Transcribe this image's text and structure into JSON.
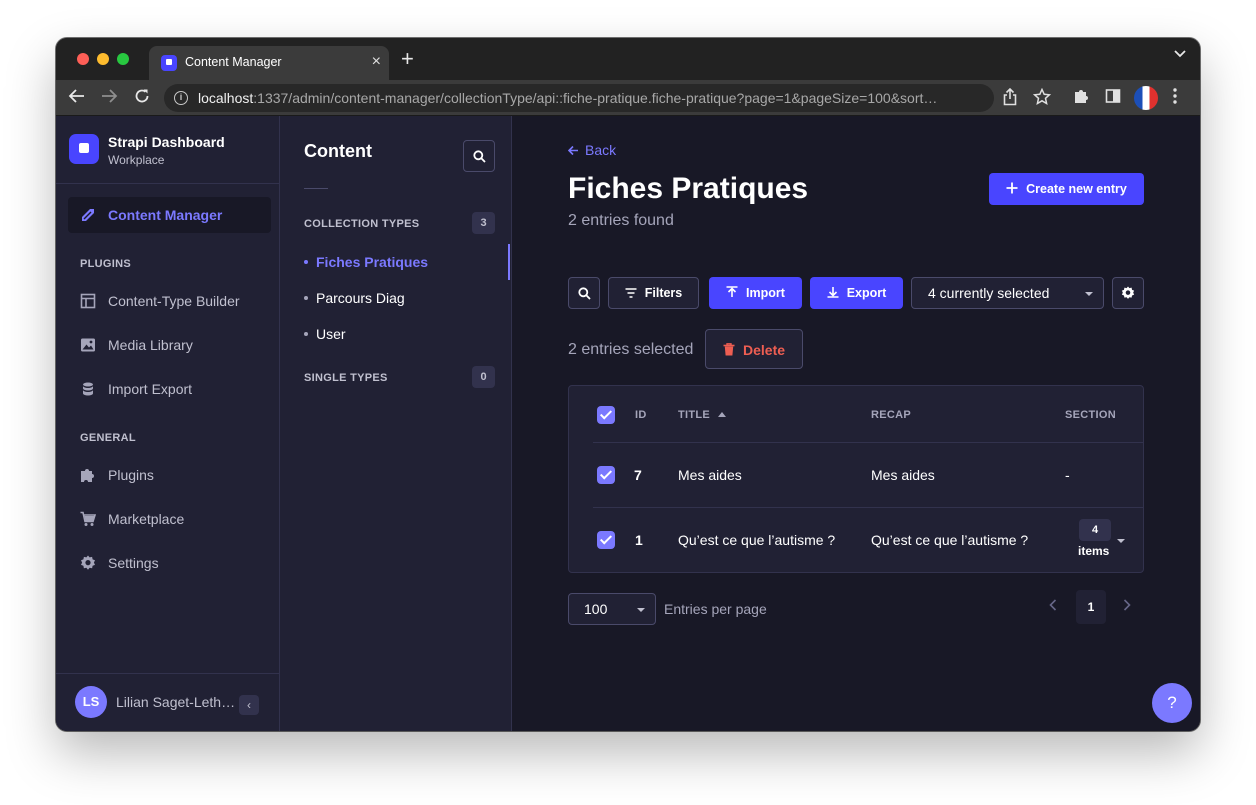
{
  "browser": {
    "tab_title": "Content Manager",
    "tab_close": "×",
    "new_tab": "+",
    "tablist": "⌄",
    "url_host": "localhost",
    "url_rest": ":1337/admin/content-manager/collectionType/api::fiche-pratique.fiche-pratique?page=1&pageSize=100&sort…"
  },
  "sidebar": {
    "brand_title": "Strapi Dashboard",
    "brand_subtitle": "Workplace",
    "active_item": "Content Manager",
    "plugins_heading": "PLUGINS",
    "plugins": [
      {
        "label": "Content-Type Builder",
        "icon": "layout-icon"
      },
      {
        "label": "Media Library",
        "icon": "image-icon"
      },
      {
        "label": "Import Export",
        "icon": "database-icon"
      }
    ],
    "general_heading": "GENERAL",
    "general": [
      {
        "label": "Plugins",
        "icon": "puzzle-icon"
      },
      {
        "label": "Marketplace",
        "icon": "cart-icon"
      },
      {
        "label": "Settings",
        "icon": "gear-icon"
      }
    ],
    "user_initials": "LS",
    "user_name": "Lilian Saget-Leth…",
    "collapse_icon": "‹"
  },
  "subnav": {
    "title": "Content",
    "collection_heading": "COLLECTION TYPES",
    "collection_count": "3",
    "collection_items": [
      "Fiches Pratiques",
      "Parcours Diag",
      "User"
    ],
    "single_heading": "SINGLE TYPES",
    "single_count": "0"
  },
  "main": {
    "back_label": "Back",
    "title": "Fiches Pratiques",
    "subtitle": "2 entries found",
    "create_label": "Create new entry",
    "filters_label": "Filters",
    "import_label": "Import",
    "export_label": "Export",
    "columns_select": "4 currently selected",
    "selected_text": "2 entries selected",
    "delete_label": "Delete",
    "table": {
      "headers": [
        "ID",
        "TITLE",
        "RECAP",
        "SECTION"
      ],
      "rows": [
        {
          "id": "7",
          "title": "Mes aides",
          "recap": "Mes aides",
          "section": "-"
        },
        {
          "id": "1",
          "title": "Qu’est ce que l’autisme ?",
          "recap": "Qu’est ce que l’autisme ?",
          "section_count": "4",
          "section_label": "items"
        }
      ]
    },
    "per_page_value": "100",
    "per_page_label": "Entries per page",
    "current_page": "1",
    "help_label": "?"
  },
  "colors": {
    "accent": "#7b79ff",
    "primary": "#4945ff",
    "danger": "#ee5e52",
    "background": "#181826",
    "surface": "#212134"
  }
}
